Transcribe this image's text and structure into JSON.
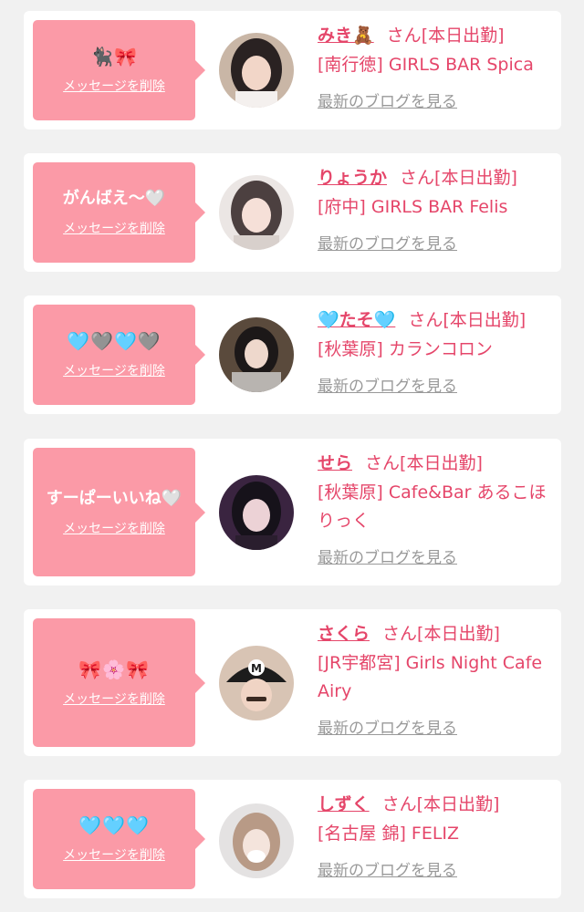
{
  "delete_label": "メッセージを削除",
  "san_label": "さん",
  "status_label": "[本日出勤]",
  "blog_label": "最新のブログを見る",
  "colors": {
    "accent_pink": "#e5466a",
    "bubble_pink": "#fb9aa7",
    "background": "#f1f1f1"
  },
  "cards": [
    {
      "message": "🐈‍⬛🎀",
      "name": "みき🧸",
      "shop": "[南行徳] GIRLS BAR Spica"
    },
    {
      "message": "がんばえ〜🤍",
      "name": "りょうか",
      "shop": "[府中] GIRLS BAR Felis"
    },
    {
      "message": "🩵🩶🩵🩶",
      "name": "🩵たそ🩵",
      "shop": "[秋葉原] カランコロン"
    },
    {
      "message": "すーぱーいいね🤍",
      "name": "せら",
      "shop": "[秋葉原] Cafe&Bar あるこほりっく"
    },
    {
      "message": "🎀🌸🎀",
      "name": "さくら",
      "shop": "[JR宇都宮] Girls Night Cafe Airy"
    },
    {
      "message": "🩵🩵🩵",
      "name": "しずく",
      "shop": "[名古屋 錦] FELIZ"
    }
  ]
}
